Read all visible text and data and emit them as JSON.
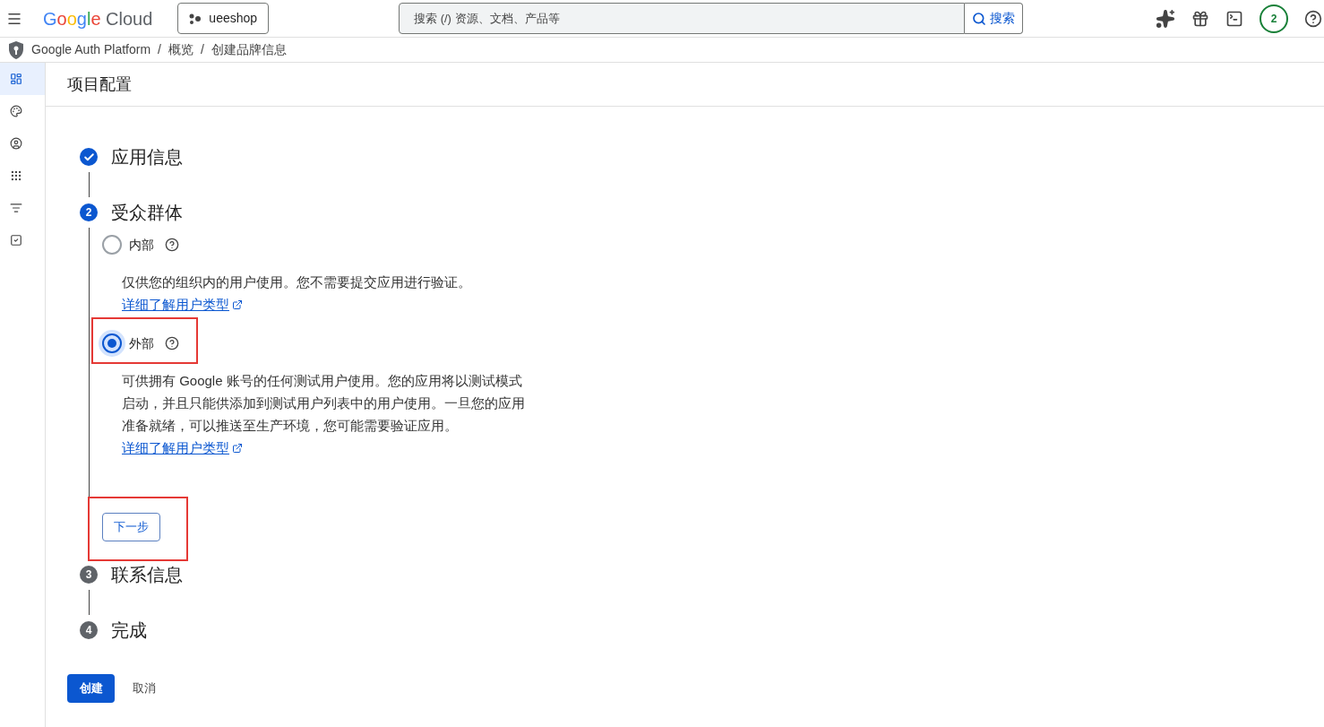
{
  "topbar": {
    "logo_brand": "Google",
    "logo_product": "Cloud",
    "project": "ueeshop",
    "search_placeholder": "搜索 (/) 资源、文档、产品等",
    "search_button": "搜索",
    "notification_count": "2"
  },
  "breadcrumb": [
    {
      "text": "Google Auth Platform"
    },
    {
      "separator": "/",
      "text": "概览"
    },
    {
      "separator": "/",
      "text": "创建品牌信息"
    }
  ],
  "sidebar": {
    "items": [
      {
        "selected": true
      },
      {
        "selected": false
      },
      {
        "selected": false
      },
      {
        "selected": false
      },
      {
        "selected": false
      },
      {
        "selected": false
      }
    ]
  },
  "page_title": "项目配置",
  "steps": [
    {
      "title": "应用信息",
      "kind": "done"
    },
    {
      "number": "2",
      "title": "受众群体",
      "kind": "current",
      "options": [
        {
          "label": "内部",
          "selected": false,
          "description": "仅供您的组织内的用户使用。您不需要提交应用进行验证。",
          "link": "详细了解用户类型"
        },
        {
          "label": "外部",
          "selected": true,
          "description": "可供拥有 Google 账号的任何测试用户使用。您的应用将以测试模式启动，并且只能供添加到测试用户列表中的用户使用。一旦您的应用准备就绪，可以推送至生产环境，您可能需要验证应用。",
          "link": "详细了解用户类型"
        }
      ],
      "next_button": "下一步"
    },
    {
      "number": "3",
      "title": "联系信息",
      "kind": "pending"
    },
    {
      "number": "4",
      "title": "完成",
      "kind": "pending"
    }
  ],
  "actions": {
    "create": "创建",
    "cancel": "取消"
  }
}
